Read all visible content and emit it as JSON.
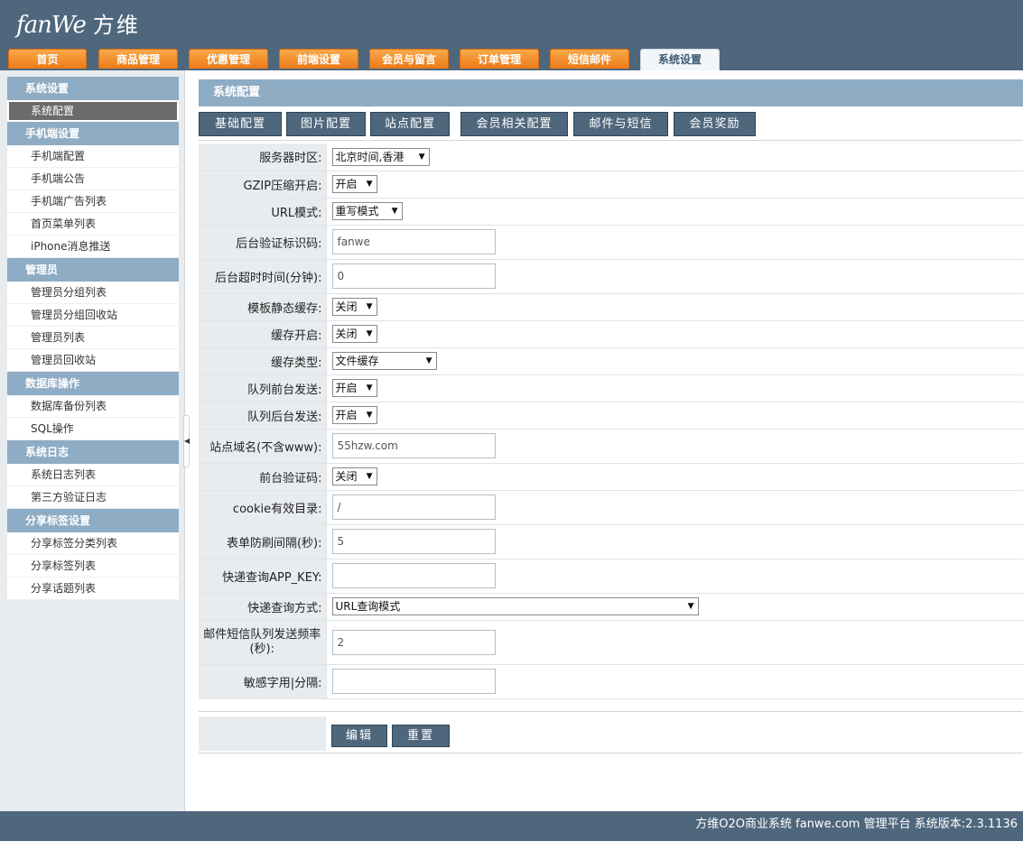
{
  "header": {
    "logo_en": "fanWe",
    "logo_cn": "方维",
    "nav": [
      {
        "label": "首页"
      },
      {
        "label": "商品管理"
      },
      {
        "label": "优惠管理"
      },
      {
        "label": "前端设置"
      },
      {
        "label": "会员与留言"
      },
      {
        "label": "订单管理"
      },
      {
        "label": "短信邮件"
      },
      {
        "label": "系统设置",
        "active": true
      }
    ]
  },
  "sidebar": {
    "groups": [
      {
        "title": "系统设置",
        "items": [
          "系统配置"
        ]
      },
      {
        "title": "手机端设置",
        "items": [
          "手机端配置",
          "手机端公告",
          "手机端广告列表",
          "首页菜单列表",
          "iPhone消息推送"
        ]
      },
      {
        "title": "管理员",
        "items": [
          "管理员分组列表",
          "管理员分组回收站",
          "管理员列表",
          "管理员回收站"
        ]
      },
      {
        "title": "数据库操作",
        "items": [
          "数据库备份列表",
          "SQL操作"
        ]
      },
      {
        "title": "系统日志",
        "items": [
          "系统日志列表",
          "第三方验证日志"
        ]
      },
      {
        "title": "分享标签设置",
        "items": [
          "分享标签分类列表",
          "分享标签列表",
          "分享话题列表"
        ]
      }
    ],
    "active_item": "系统配置"
  },
  "main": {
    "title": "系统配置",
    "tabs": [
      "基础配置",
      "图片配置",
      "站点配置",
      "会员相关配置",
      "邮件与短信",
      "会员奖励"
    ],
    "fields": [
      {
        "label": "服务器时区:",
        "type": "select",
        "value": "北京时间,香港"
      },
      {
        "label": "GZIP压缩开启:",
        "type": "select",
        "value": "开启"
      },
      {
        "label": "URL模式:",
        "type": "select",
        "value": "重写模式"
      },
      {
        "label": "后台验证标识码:",
        "type": "text",
        "value": "fanwe"
      },
      {
        "label": "后台超时时间(分钟):",
        "type": "text",
        "value": "0"
      },
      {
        "label": "模板静态缓存:",
        "type": "select",
        "value": "关闭"
      },
      {
        "label": "缓存开启:",
        "type": "select",
        "value": "关闭"
      },
      {
        "label": "缓存类型:",
        "type": "select",
        "value": "文件缓存"
      },
      {
        "label": "队列前台发送:",
        "type": "select",
        "value": "开启"
      },
      {
        "label": "队列后台发送:",
        "type": "select",
        "value": "开启"
      },
      {
        "label": "站点域名(不含www):",
        "type": "text",
        "value": "55hzw.com"
      },
      {
        "label": "前台验证码:",
        "type": "select",
        "value": "关闭"
      },
      {
        "label": "cookie有效目录:",
        "type": "text",
        "value": "/"
      },
      {
        "label": "表单防刷间隔(秒):",
        "type": "text",
        "value": "5"
      },
      {
        "label": "快递查询APP_KEY:",
        "type": "text",
        "value": ""
      },
      {
        "label": "快递查询方式:",
        "type": "select",
        "value": "URL查询模式"
      },
      {
        "label": "邮件短信队列发送频率(秒):",
        "type": "text",
        "value": "2"
      },
      {
        "label": "敏感字用|分隔:",
        "type": "text",
        "value": ""
      }
    ],
    "buttons": {
      "edit": "编辑",
      "reset": "重置"
    }
  },
  "footer": {
    "text": "方维O2O商业系统 fanwe.com 管理平台 系统版本:2.3.1136"
  }
}
